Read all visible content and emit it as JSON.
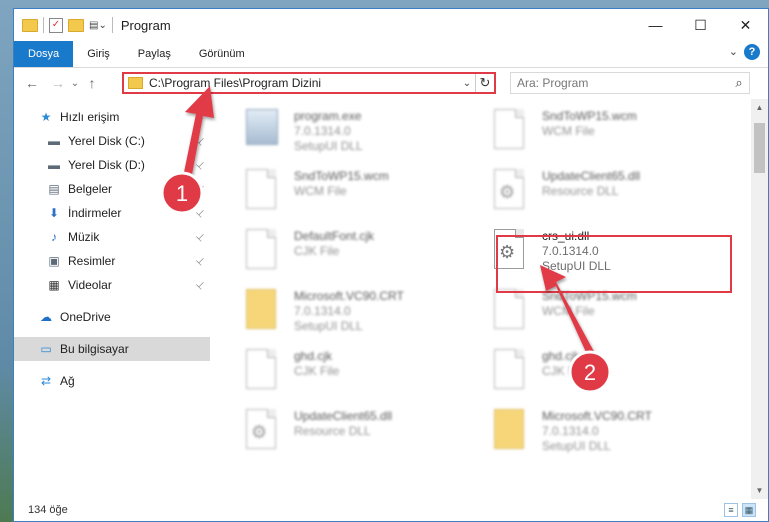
{
  "window": {
    "title": "Program",
    "minimize_glyph": "—",
    "maximize_glyph": "☐",
    "close_glyph": "✕"
  },
  "ribbon": {
    "tabs": [
      "Dosya",
      "Giriş",
      "Paylaş",
      "Görünüm"
    ],
    "active_tab": "Dosya",
    "help_glyph": "?",
    "expand_glyph": "⌄"
  },
  "navigation": {
    "back_glyph": "←",
    "forward_glyph": "→",
    "recent_glyph": "⌄",
    "up_glyph": "↑"
  },
  "address_bar": {
    "path": "C:\\Program Files\\Program Dizini",
    "dropdown_glyph": "⌄",
    "refresh_glyph": "↻"
  },
  "search": {
    "placeholder": "Ara: Program",
    "icon_glyph": "⌕"
  },
  "sidebar": {
    "items": [
      {
        "label": "Hızlı erişim",
        "icon": "star-icon",
        "glyph": "★",
        "color": "#2b8ad6",
        "pinned": false
      },
      {
        "label": "Yerel Disk (C:)",
        "icon": "drive-icon",
        "glyph": "▬",
        "color": "#5d6a78",
        "pinned": true
      },
      {
        "label": "Yerel Disk (D:)",
        "icon": "drive-icon",
        "glyph": "▬",
        "color": "#5d6a78",
        "pinned": true
      },
      {
        "label": "Belgeler",
        "icon": "document-icon",
        "glyph": "▤",
        "color": "#5d6a78",
        "pinned": true
      },
      {
        "label": "İndirmeler",
        "icon": "download-icon",
        "glyph": "⬇",
        "color": "#2b72c4",
        "pinned": true
      },
      {
        "label": "Müzik",
        "icon": "music-icon",
        "glyph": "♪",
        "color": "#2b72c4",
        "pinned": true
      },
      {
        "label": "Resimler",
        "icon": "pictures-icon",
        "glyph": "▣",
        "color": "#5d6a78",
        "pinned": true
      },
      {
        "label": "Videolar",
        "icon": "video-icon",
        "glyph": "▦",
        "color": "#333",
        "pinned": true
      },
      {
        "label": "OneDrive",
        "icon": "cloud-icon",
        "glyph": "☁",
        "color": "#1e6fc7",
        "pinned": false
      },
      {
        "label": "Bu bilgisayar",
        "icon": "computer-icon",
        "glyph": "▭",
        "color": "#2b8ad6",
        "pinned": false,
        "selected": true
      },
      {
        "label": "Ağ",
        "icon": "network-icon",
        "glyph": "⇄",
        "color": "#2b8ad6",
        "pinned": false
      }
    ],
    "pin_glyph": "📌"
  },
  "files": [
    {
      "name": "program.exe",
      "line2": "7.0.1314.0",
      "line3": "SetupUI DLL",
      "kind": "exe"
    },
    {
      "name": "SndToWP15.wcm",
      "line2": "WCM File",
      "line3": "",
      "kind": "page"
    },
    {
      "name": "SndToWP15.wcm",
      "line2": "WCM File",
      "line3": "",
      "kind": "page"
    },
    {
      "name": "UpdateClient65.dll",
      "line2": "Resource DLL",
      "line3": "",
      "kind": "dll"
    },
    {
      "name": "DefaultFont.cjk",
      "line2": "CJK File",
      "line3": "",
      "kind": "page"
    },
    {
      "name": "crs_ui.dll",
      "line2": "7.0.1314.0",
      "line3": "SetupUI DLL",
      "kind": "dll",
      "clear": true
    },
    {
      "name": "Microsoft.VC90.CRT",
      "line2": "7.0.1314.0",
      "line3": "SetupUI DLL",
      "kind": "zip"
    },
    {
      "name": "SndToWP15.wcm",
      "line2": "WCM File",
      "line3": "",
      "kind": "page"
    },
    {
      "name": "ghd.cjk",
      "line2": "CJK File",
      "line3": "",
      "kind": "page"
    },
    {
      "name": "ghd.cjk",
      "line2": "CJK File",
      "line3": "",
      "kind": "page"
    },
    {
      "name": "UpdateClient65.dll",
      "line2": "Resource DLL",
      "line3": "",
      "kind": "dll"
    },
    {
      "name": "Microsoft.VC90.CRT",
      "line2": "7.0.1314.0",
      "line3": "SetupUI DLL",
      "kind": "zip"
    }
  ],
  "status": {
    "count": "134 öğe"
  },
  "callouts": [
    {
      "number": "1"
    },
    {
      "number": "2"
    }
  ],
  "colors": {
    "accent": "#1979ca",
    "highlight": "#e03a46"
  }
}
